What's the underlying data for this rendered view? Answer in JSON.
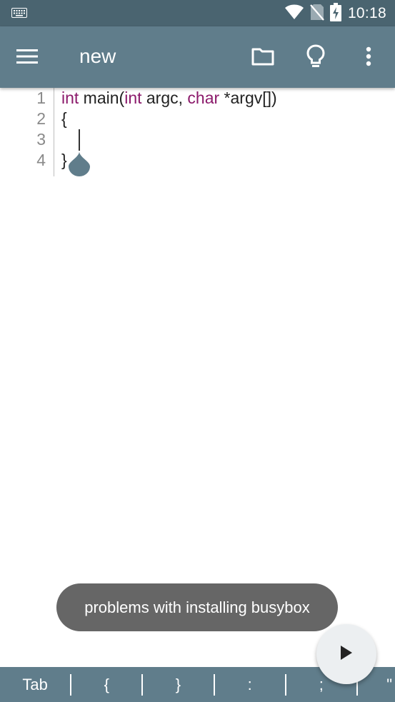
{
  "status_bar": {
    "time": "10:18"
  },
  "toolbar": {
    "title": "new"
  },
  "editor": {
    "lines": [
      {
        "num": "1",
        "tokens": [
          "int",
          " main(",
          "int",
          " argc, ",
          "char",
          " *argv[])"
        ]
      },
      {
        "num": "2",
        "text": "{"
      },
      {
        "num": "3",
        "text": ""
      },
      {
        "num": "4",
        "text": "}"
      }
    ]
  },
  "toast": {
    "message": "problems with installing busybox"
  },
  "keybar": {
    "keys": [
      "Tab",
      "{",
      "}",
      ":",
      ";",
      "\""
    ]
  },
  "colors": {
    "status_bar": "#4a6470",
    "toolbar": "#607d8b",
    "keyword": "#8b1a6b",
    "toast": "#666666",
    "fab": "#eceff1"
  },
  "icons": [
    "keyboard-icon",
    "wifi-icon",
    "no-sim-icon",
    "battery-charging-icon",
    "menu-icon",
    "folder-icon",
    "lightbulb-icon",
    "more-vert-icon",
    "play-icon",
    "cursor-handle-icon"
  ]
}
